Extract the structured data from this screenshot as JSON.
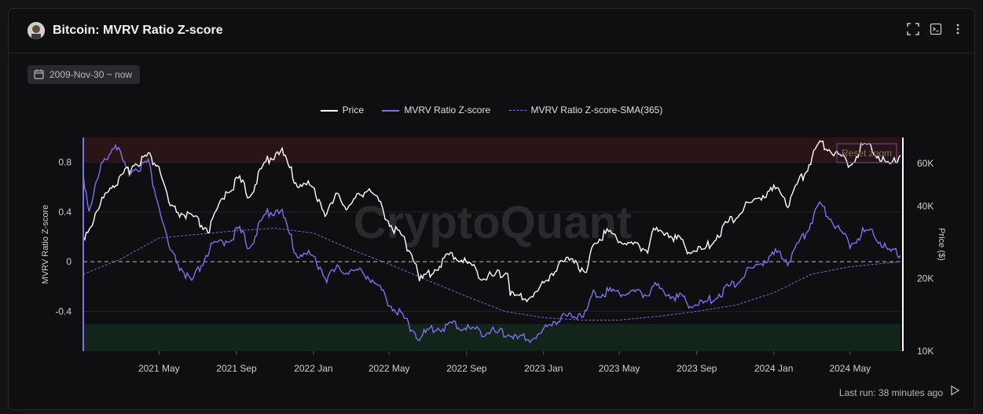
{
  "header": {
    "title": "Bitcoin: MVRV Ratio Z-score"
  },
  "date_range": "2009-Nov-30 ~ now",
  "footer": {
    "last_run": "Last run: 38 minutes ago"
  },
  "watermark": "CryptoQuant",
  "reset_zoom": "Reset zoom",
  "colors": {
    "price": "#ffffff",
    "zscore": "#7b72f0",
    "sma": "#6f68d8",
    "upper_band": "#2a1416",
    "lower_band": "#13241a"
  },
  "chart_data": {
    "type": "line",
    "title": "Bitcoin: MVRV Ratio Z-score",
    "legend": [
      "Price",
      "MVRV Ratio Z-score",
      "MVRV Ratio Z-score-SMA(365)"
    ],
    "legend_position": "top-center",
    "x_tick_labels": [
      "2021 May",
      "2021 Sep",
      "2022 Jan",
      "2022 May",
      "2022 Sep",
      "2023 Jan",
      "2023 May",
      "2023 Sep",
      "2024 Jan",
      "2024 May"
    ],
    "y_left": {
      "label": "MVRV Ratio Z-score",
      "ticks": [
        0.8,
        0.4,
        0,
        -0.4
      ],
      "range": [
        -0.72,
        1.0
      ]
    },
    "y_right": {
      "label": "Price ($)",
      "ticks": [
        "60K",
        "40K",
        "20K",
        "10K"
      ],
      "scale": "log",
      "range": [
        10000,
        77000
      ]
    },
    "bands": {
      "upper": [
        0.8,
        1.0
      ],
      "lower": [
        -0.72,
        -0.5
      ]
    },
    "grid": true,
    "series": [
      {
        "name": "Price",
        "axis": "right",
        "x": [
          "2021-01-01",
          "2021-01-20",
          "2021-02-10",
          "2021-03-01",
          "2021-03-20",
          "2021-04-14",
          "2021-05-01",
          "2021-05-19",
          "2021-06-20",
          "2021-07-20",
          "2021-08-15",
          "2021-09-06",
          "2021-09-21",
          "2021-10-20",
          "2021-11-10",
          "2021-12-04",
          "2021-12-31",
          "2022-01-22",
          "2022-02-10",
          "2022-02-24",
          "2022-03-28",
          "2022-04-15",
          "2022-05-09",
          "2022-05-20",
          "2022-06-13",
          "2022-06-18",
          "2022-07-10",
          "2022-07-30",
          "2022-08-14",
          "2022-09-10",
          "2022-09-30",
          "2022-10-25",
          "2022-11-05",
          "2022-11-09",
          "2022-11-21",
          "2022-12-20",
          "2023-01-14",
          "2023-02-16",
          "2023-03-10",
          "2023-03-21",
          "2023-04-14",
          "2023-05-15",
          "2023-06-15",
          "2023-06-22",
          "2023-07-14",
          "2023-08-17",
          "2023-09-11",
          "2023-10-24",
          "2023-12-05",
          "2024-01-11",
          "2024-01-23",
          "2024-02-14",
          "2024-03-14",
          "2024-04-15",
          "2024-05-01",
          "2024-05-21",
          "2024-06-10",
          "2024-07-05",
          "2024-07-20"
        ],
        "values": [
          29000,
          35000,
          47000,
          50000,
          58000,
          63000,
          57000,
          38000,
          35000,
          31000,
          45000,
          50000,
          43000,
          61000,
          67000,
          49000,
          46500,
          36000,
          44000,
          38000,
          47000,
          40000,
          31000,
          29500,
          23000,
          19000,
          21000,
          23800,
          24300,
          21800,
          19500,
          20300,
          21000,
          17000,
          16000,
          16800,
          20800,
          24300,
          20000,
          28000,
          30500,
          27000,
          26000,
          30000,
          31000,
          26000,
          25200,
          34000,
          42000,
          46500,
          39500,
          51000,
          72000,
          63000,
          58000,
          70000,
          66000,
          56000,
          65000
        ]
      },
      {
        "name": "MVRV Ratio Z-score",
        "axis": "left",
        "x": [
          "2021-01-01",
          "2021-01-10",
          "2021-02-01",
          "2021-02-21",
          "2021-03-10",
          "2021-04-14",
          "2021-05-01",
          "2021-05-19",
          "2021-06-22",
          "2021-07-20",
          "2021-08-15",
          "2021-09-06",
          "2021-09-21",
          "2021-10-20",
          "2021-11-10",
          "2021-12-04",
          "2022-01-01",
          "2022-01-22",
          "2022-02-10",
          "2022-03-28",
          "2022-05-09",
          "2022-05-20",
          "2022-06-18",
          "2022-07-10",
          "2022-08-14",
          "2022-09-10",
          "2022-10-25",
          "2022-11-09",
          "2022-11-21",
          "2022-12-25",
          "2023-01-14",
          "2023-03-10",
          "2023-03-21",
          "2023-04-14",
          "2023-06-15",
          "2023-06-22",
          "2023-07-14",
          "2023-08-17",
          "2023-09-11",
          "2023-10-24",
          "2023-12-05",
          "2024-01-11",
          "2024-01-23",
          "2024-02-14",
          "2024-03-14",
          "2024-04-15",
          "2024-05-01",
          "2024-05-21",
          "2024-06-10",
          "2024-07-05",
          "2024-07-20"
        ],
        "values": [
          0.68,
          0.4,
          0.78,
          0.94,
          0.7,
          0.78,
          0.42,
          0.05,
          -0.2,
          0.08,
          0.15,
          0.23,
          0.1,
          0.38,
          0.4,
          0.05,
          0.02,
          -0.15,
          -0.08,
          -0.12,
          -0.4,
          -0.45,
          -0.63,
          -0.56,
          -0.53,
          -0.57,
          -0.6,
          -0.6,
          -0.65,
          -0.62,
          -0.5,
          -0.42,
          -0.28,
          -0.26,
          -0.28,
          -0.22,
          -0.26,
          -0.35,
          -0.37,
          -0.22,
          -0.05,
          0.06,
          -0.02,
          0.15,
          0.45,
          0.23,
          0.12,
          0.22,
          0.2,
          0.04,
          0.05
        ]
      },
      {
        "name": "MVRV Ratio Z-score-SMA(365)",
        "axis": "left",
        "x": [
          "2021-01-01",
          "2021-03-01",
          "2021-05-01",
          "2021-07-01",
          "2021-09-01",
          "2021-11-01",
          "2022-01-01",
          "2022-03-01",
          "2022-05-01",
          "2022-07-01",
          "2022-09-01",
          "2022-11-01",
          "2023-01-01",
          "2023-03-01",
          "2023-05-01",
          "2023-07-01",
          "2023-09-01",
          "2023-11-01",
          "2024-01-01",
          "2024-03-01",
          "2024-05-01",
          "2024-07-20"
        ],
        "values": [
          -0.1,
          0.02,
          0.19,
          0.22,
          0.25,
          0.27,
          0.23,
          0.1,
          -0.02,
          -0.15,
          -0.28,
          -0.4,
          -0.45,
          -0.47,
          -0.47,
          -0.44,
          -0.4,
          -0.35,
          -0.25,
          -0.1,
          -0.04,
          0.0
        ]
      }
    ]
  }
}
